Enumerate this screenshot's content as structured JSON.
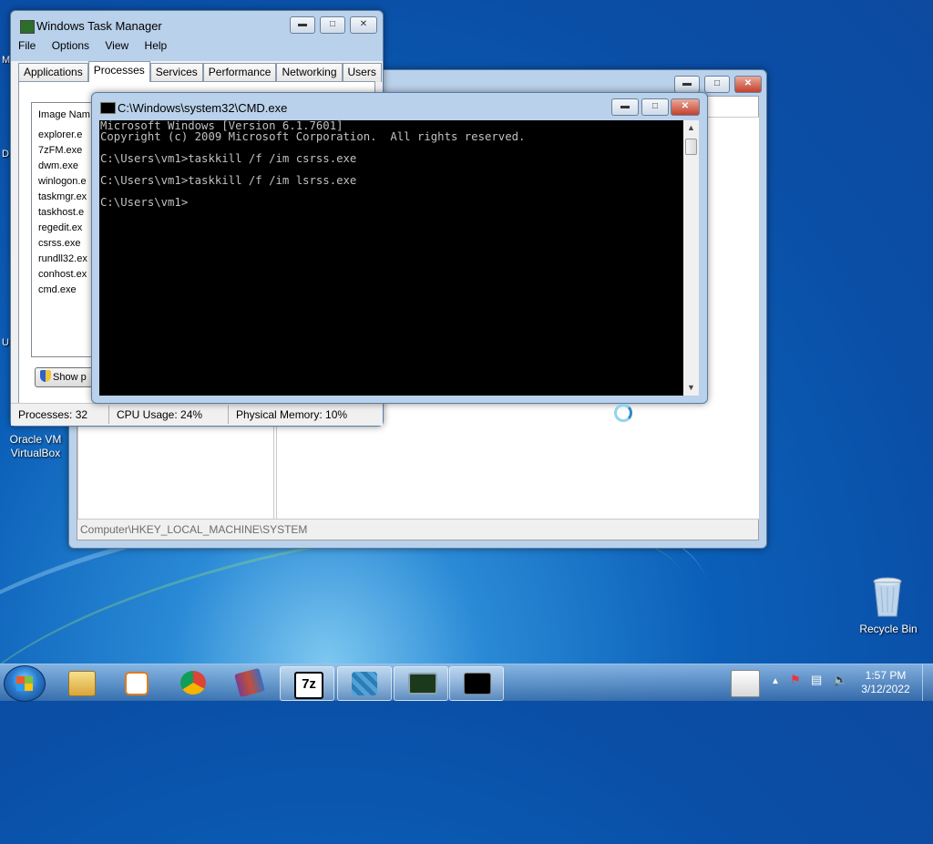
{
  "desktop": {
    "icons": [
      {
        "label": "Oracle VM\nVirtualBox"
      },
      {
        "label": "Recycle Bin"
      }
    ],
    "edge_letters": [
      "M",
      "D",
      "U"
    ]
  },
  "task_manager": {
    "title": "Windows Task Manager",
    "menu": [
      "File",
      "Options",
      "View",
      "Help"
    ],
    "tabs": [
      "Applications",
      "Processes",
      "Services",
      "Performance",
      "Networking",
      "Users"
    ],
    "active_tab": "Processes",
    "column_header": "Image Nam",
    "processes": [
      "explorer.e",
      "7zFM.exe",
      "dwm.exe",
      "winlogon.e",
      "taskmgr.ex",
      "taskhost.e",
      "regedit.ex",
      "csrss.exe",
      "rundll32.ex",
      "conhost.ex",
      "cmd.exe"
    ],
    "show_button": "Show p",
    "status": {
      "processes": "Processes: 32",
      "cpu": "CPU Usage: 24%",
      "memory": "Physical Memory: 10%"
    }
  },
  "regedit": {
    "status_path": "Computer\\HKEY_LOCAL_MACHINE\\SYSTEM"
  },
  "cmd": {
    "title": "C:\\Windows\\system32\\CMD.exe",
    "output": "Microsoft Windows [Version 6.1.7601]\nCopyright (c) 2009 Microsoft Corporation.  All rights reserved.\n\nC:\\Users\\vm1>taskkill /f /im csrss.exe\n\nC:\\Users\\vm1>taskkill /f /im lsrss.exe\n\nC:\\Users\\vm1>"
  },
  "taskbar": {
    "items": [
      {
        "name": "windows-explorer",
        "active": false
      },
      {
        "name": "windows-media-player",
        "active": false
      },
      {
        "name": "google-chrome",
        "active": false
      },
      {
        "name": "winrar",
        "active": false
      },
      {
        "name": "7-zip",
        "active": true
      },
      {
        "name": "registry-editor",
        "active": true
      },
      {
        "name": "task-manager",
        "active": true
      },
      {
        "name": "command-prompt",
        "active": true
      }
    ],
    "clock_time": "1:57 PM",
    "clock_date": "3/12/2022"
  },
  "colors": {
    "console_bg": "#000000",
    "console_fg": "#c0c0c0",
    "desktop": "#0b5fb8"
  }
}
